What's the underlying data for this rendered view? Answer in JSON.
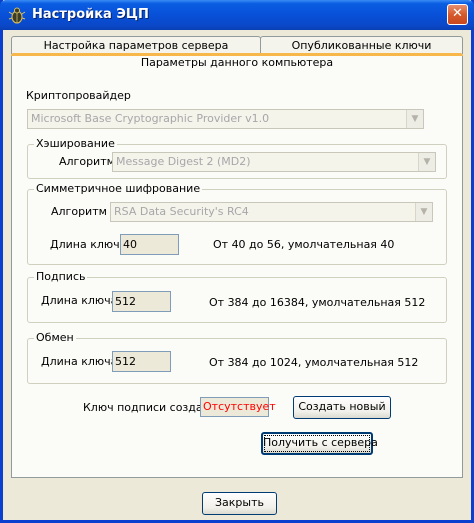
{
  "window": {
    "title": "Настройка ЭЦП",
    "close_glyph": "✕"
  },
  "tabs": {
    "back_row": [
      "Настройка параметров сервера",
      "Опубликованные ключи"
    ],
    "active": "Параметры данного компьютера"
  },
  "crypto_provider": {
    "label": "Криптопровайдер",
    "value": "Microsoft Base Cryptographic Provider v1.0"
  },
  "hashing": {
    "group_title": "Хэширование",
    "algorithm_label": "Алгоритм",
    "algorithm_value": "Message Digest 2 (MD2)"
  },
  "symmetric": {
    "group_title": "Симметричное шифрование",
    "algorithm_label": "Алгоритм",
    "algorithm_value": "RSA Data Security's RC4",
    "key_length_label": "Длина ключа",
    "key_length_value": "40",
    "range_hint": "От 40 до 56, умолчательная 40"
  },
  "signature": {
    "group_title": "Подпись",
    "key_length_label": "Длина ключа",
    "key_length_value": "512",
    "range_hint": "От 384 до 16384, умолчательная 512"
  },
  "exchange": {
    "group_title": "Обмен",
    "key_length_label": "Длина ключа",
    "key_length_value": "512",
    "range_hint": "От 384 до 1024, умолчательная 512"
  },
  "signing_key": {
    "label": "Ключ подписи создан",
    "status": "Отсутствует",
    "create_button": "Создать новый",
    "get_from_server_button": "Получить с сервера"
  },
  "footer": {
    "close_button": "Закрыть"
  },
  "colors": {
    "title_bar": "#0a5de2",
    "status_missing": "#ff0000",
    "window_bg": "#ece9d8"
  },
  "icons": {
    "app": "beetle-icon",
    "dropdown": "chevron-down-icon"
  }
}
